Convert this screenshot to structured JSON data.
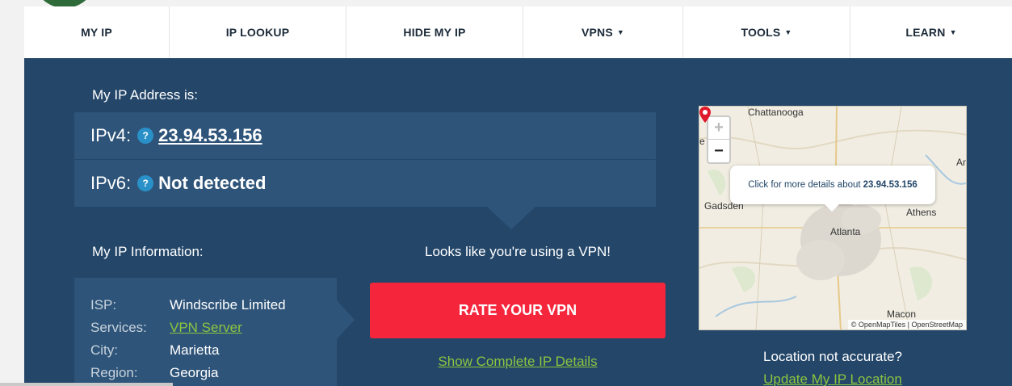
{
  "nav": {
    "items": [
      {
        "label": "MY IP",
        "caret": ""
      },
      {
        "label": "IP LOOKUP",
        "caret": ""
      },
      {
        "label": "HIDE MY IP",
        "caret": ""
      },
      {
        "label": "VPNS",
        "caret": "▼"
      },
      {
        "label": "TOOLS",
        "caret": "▼"
      },
      {
        "label": "LEARN",
        "caret": "▼"
      }
    ]
  },
  "ip": {
    "heading": "My IP Address is:",
    "ipv4_label": "IPv4:",
    "ipv4_value": "23.94.53.156",
    "ipv6_label": "IPv6:",
    "ipv6_value": "Not detected",
    "help_glyph": "?"
  },
  "info": {
    "heading": "My IP Information:",
    "rows": [
      {
        "key": "ISP:",
        "value": "Windscribe Limited"
      },
      {
        "key": "Services:",
        "value": "VPN Server"
      },
      {
        "key": "City:",
        "value": "Marietta"
      },
      {
        "key": "Region:",
        "value": "Georgia"
      }
    ]
  },
  "vpn": {
    "message": "Looks like you're using a VPN!",
    "rate_button": "RATE YOUR VPN",
    "details_link": "Show Complete IP Details"
  },
  "map": {
    "zoom_in": "+",
    "zoom_out": "−",
    "popup_text": "Click for more details about",
    "popup_ip": "23.94.53.156",
    "cities": {
      "chattanooga": "Chattanooga",
      "gadsden": "Gadsden",
      "atlanta": "Atlanta",
      "athens": "Athens",
      "macon": "Macon",
      "edge_right": "An",
      "edge_left": "e"
    },
    "attribution": "© OpenMapTiles | OpenStreetMap"
  },
  "location": {
    "question": "Location not accurate?",
    "update_link": "Update My IP Location"
  },
  "colors": {
    "panel": "#234669",
    "box": "#2e5479",
    "accent_red": "#f5263c",
    "link_green": "#8cc63f"
  }
}
